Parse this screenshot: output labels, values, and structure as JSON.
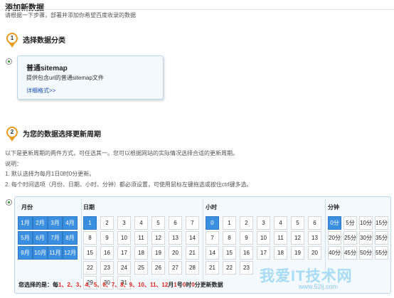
{
  "page": {
    "title": "添加新数据",
    "subtitle": "请根据一下步骤，部署并添加你希望百度收录的数据"
  },
  "step1": {
    "number": "1",
    "title": "选择数据分类",
    "card": {
      "title": "普通sitemap",
      "description": "提供包含url的普通sitemap文件",
      "link": "详细格式>>"
    }
  },
  "step2": {
    "number": "2",
    "title": "为您的数据选择更新周期",
    "intro": "以下是更新周期的两件方式，可任选其一。您可以根据网站的实际情况选择合适的更新周期。",
    "note_label": "说明：",
    "notes": [
      "1. 默认选择为每月1日0时0分更新。",
      "2. 每个时间选项（月份、日期、小时、分钟）都必须设置，可使用鼠标左键拖选或按住ctrl键多选。"
    ]
  },
  "schedule": {
    "headers": {
      "month": "月份",
      "day": "日期",
      "hour": "小时",
      "minute": "分钟"
    },
    "months": [
      {
        "label": "1月",
        "selected": true
      },
      {
        "label": "2月",
        "selected": true
      },
      {
        "label": "3月",
        "selected": true
      },
      {
        "label": "4月",
        "selected": true
      },
      {
        "label": "5月",
        "selected": true
      },
      {
        "label": "6月",
        "selected": true
      },
      {
        "label": "7月",
        "selected": true
      },
      {
        "label": "8月",
        "selected": true
      },
      {
        "label": "9月",
        "selected": true
      },
      {
        "label": "10月",
        "selected": true
      },
      {
        "label": "11月",
        "selected": true
      },
      {
        "label": "12月",
        "selected": true
      }
    ],
    "days": [
      "1",
      "2",
      "3",
      "4",
      "5",
      "6",
      "7",
      "8",
      "9",
      "10",
      "11",
      "12",
      "13",
      "14",
      "15",
      "16",
      "17",
      "18",
      "19",
      "20",
      "21",
      "22",
      "23",
      "24",
      "25",
      "26",
      "27",
      "28",
      "29",
      "30",
      "31"
    ],
    "day_selected": [
      "1"
    ],
    "hours": [
      "0",
      "1",
      "2",
      "3",
      "4",
      "5",
      "6",
      "7",
      "8",
      "9",
      "10",
      "11",
      "12",
      "13",
      "14",
      "15",
      "16",
      "17",
      "18",
      "19",
      "20",
      "21",
      "22",
      "23"
    ],
    "hour_selected": [
      "0"
    ],
    "minutes": [
      "0分",
      "5分",
      "10分",
      "15分",
      "20分",
      "25分",
      "30分",
      "35分",
      "40分",
      "45分",
      "50分",
      "55分"
    ],
    "minute_selected": [
      "0分"
    ],
    "summary": {
      "prefix": "您选择的是：每",
      "months_text": "1、2、3、4、5、6、7、8、9、10、11、12",
      "mid1": "月",
      "day_text": "1",
      "mid2": "号",
      "hour_text": "0",
      "mid3": "时",
      "minute_text": "0",
      "suffix": "分更新数据"
    }
  },
  "watermark": {
    "text": "我爱IT技术网",
    "url": "www.52ij.com"
  }
}
